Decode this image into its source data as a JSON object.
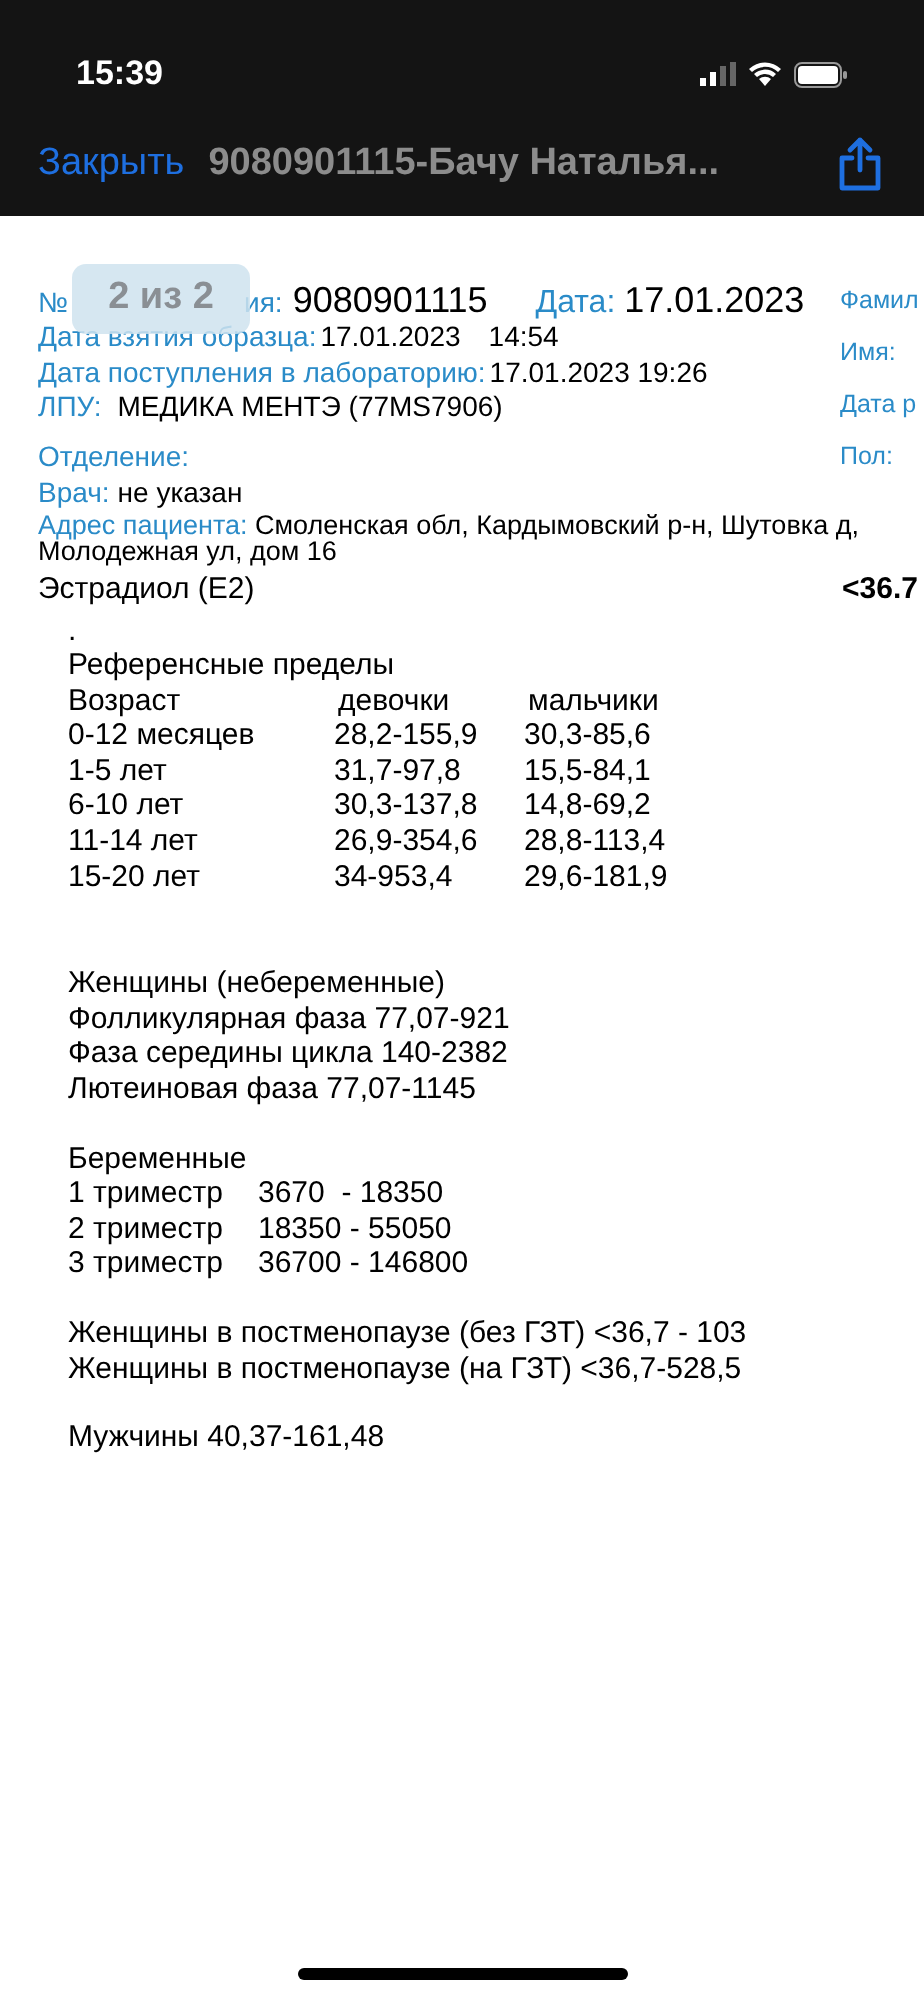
{
  "status_bar": {
    "time": "15:39"
  },
  "nav_bar": {
    "close": "Закрыть",
    "title": "9080901115-Бачу Наталья..."
  },
  "page_badge": "2 из 2",
  "header": {
    "order_label_start": "№",
    "order_label_end": "ия:",
    "order_number": "9080901115",
    "date_label": "Дата:",
    "date": "17.01.2023",
    "sample_label": "Дата взятия образца:",
    "sample_date": "17.01.2023",
    "sample_time": "14:54",
    "lab_label": "Дата поступления в лабораторию:",
    "lab_date": "17.01.2023 19:26",
    "lpu_label": "ЛПУ:",
    "lpu": "МЕДИКА МЕНТЭ (77MS7906)",
    "dept_label": "Отделение:",
    "doctor_label": "Врач:",
    "doctor": "не указан",
    "address_label": "Адрес пациента:",
    "address": "Смоленская обл, Кардымовский р-н, Шутовка д, Молодежная ул, дом 16"
  },
  "patient_labels": [
    "Фамил",
    "Имя:",
    "Дата р",
    "Пол:"
  ],
  "test": {
    "name": "Эстрадиол (Е2)",
    "result": "<36.7"
  },
  "dot": ".",
  "reference": {
    "title": "Референсные пределы",
    "columns": [
      "Возраст",
      "девочки",
      "мальчики"
    ],
    "rows": [
      [
        "0-12 месяцев",
        "28,2-155,9",
        "30,3-85,6"
      ],
      [
        "1-5 лет",
        "31,7-97,8",
        "15,5-84,1"
      ],
      [
        "6-10 лет",
        "30,3-137,8",
        "14,8-69,2"
      ],
      [
        "11-14 лет",
        "26,9-354,6",
        "28,8-113,4"
      ],
      [
        "15-20 лет",
        "34-953,4",
        "29,6-181,9"
      ]
    ]
  },
  "groups": [
    [
      "Женщины (небеременные)",
      "Фолликулярная фаза 77,07-921",
      "Фаза середины цикла 140-2382",
      "Лютеиновая фаза 77,07-1145"
    ],
    [
      "Беременные"
    ],
    [
      "Женщины в постменопаузе (без ГЗТ) <36,7 - 103",
      "Женщины в постменопаузе (на ГЗТ) <36,7-528,5"
    ],
    [
      "Мужчины 40,37-161,48"
    ]
  ],
  "trimesters": [
    [
      "1 триместр",
      "3670  - 18350"
    ],
    [
      "2 триместр",
      "18350 - 55050"
    ],
    [
      "3 триместр",
      "36700 - 146800"
    ]
  ]
}
